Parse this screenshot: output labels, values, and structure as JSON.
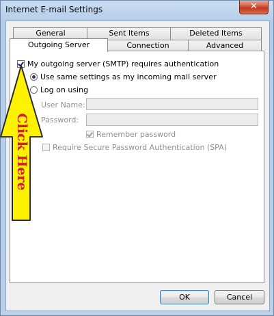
{
  "window": {
    "title": "Internet E-mail Settings",
    "close_glyph": "✕"
  },
  "tabs": {
    "general": "General",
    "sent_items": "Sent Items",
    "deleted_items": "Deleted Items",
    "outgoing_server": "Outgoing Server",
    "connection": "Connection",
    "advanced": "Advanced"
  },
  "outgoing": {
    "smtp_auth_label": "My outgoing server (SMTP) requires authentication",
    "smtp_auth_checked": true,
    "same_settings_label": "Use same settings as my incoming mail server",
    "log_on_label": "Log on using",
    "user_name_label": "User Name:",
    "user_name_value": "",
    "password_label": "Password:",
    "password_value": "",
    "remember_password_label": "Remember password",
    "spa_label": "Require Secure Password Authentication (SPA)"
  },
  "annotation": {
    "text": "Click Here",
    "fill_color": "#fff200",
    "text_color": "#d0202a"
  },
  "buttons": {
    "ok": "OK",
    "cancel": "Cancel"
  }
}
